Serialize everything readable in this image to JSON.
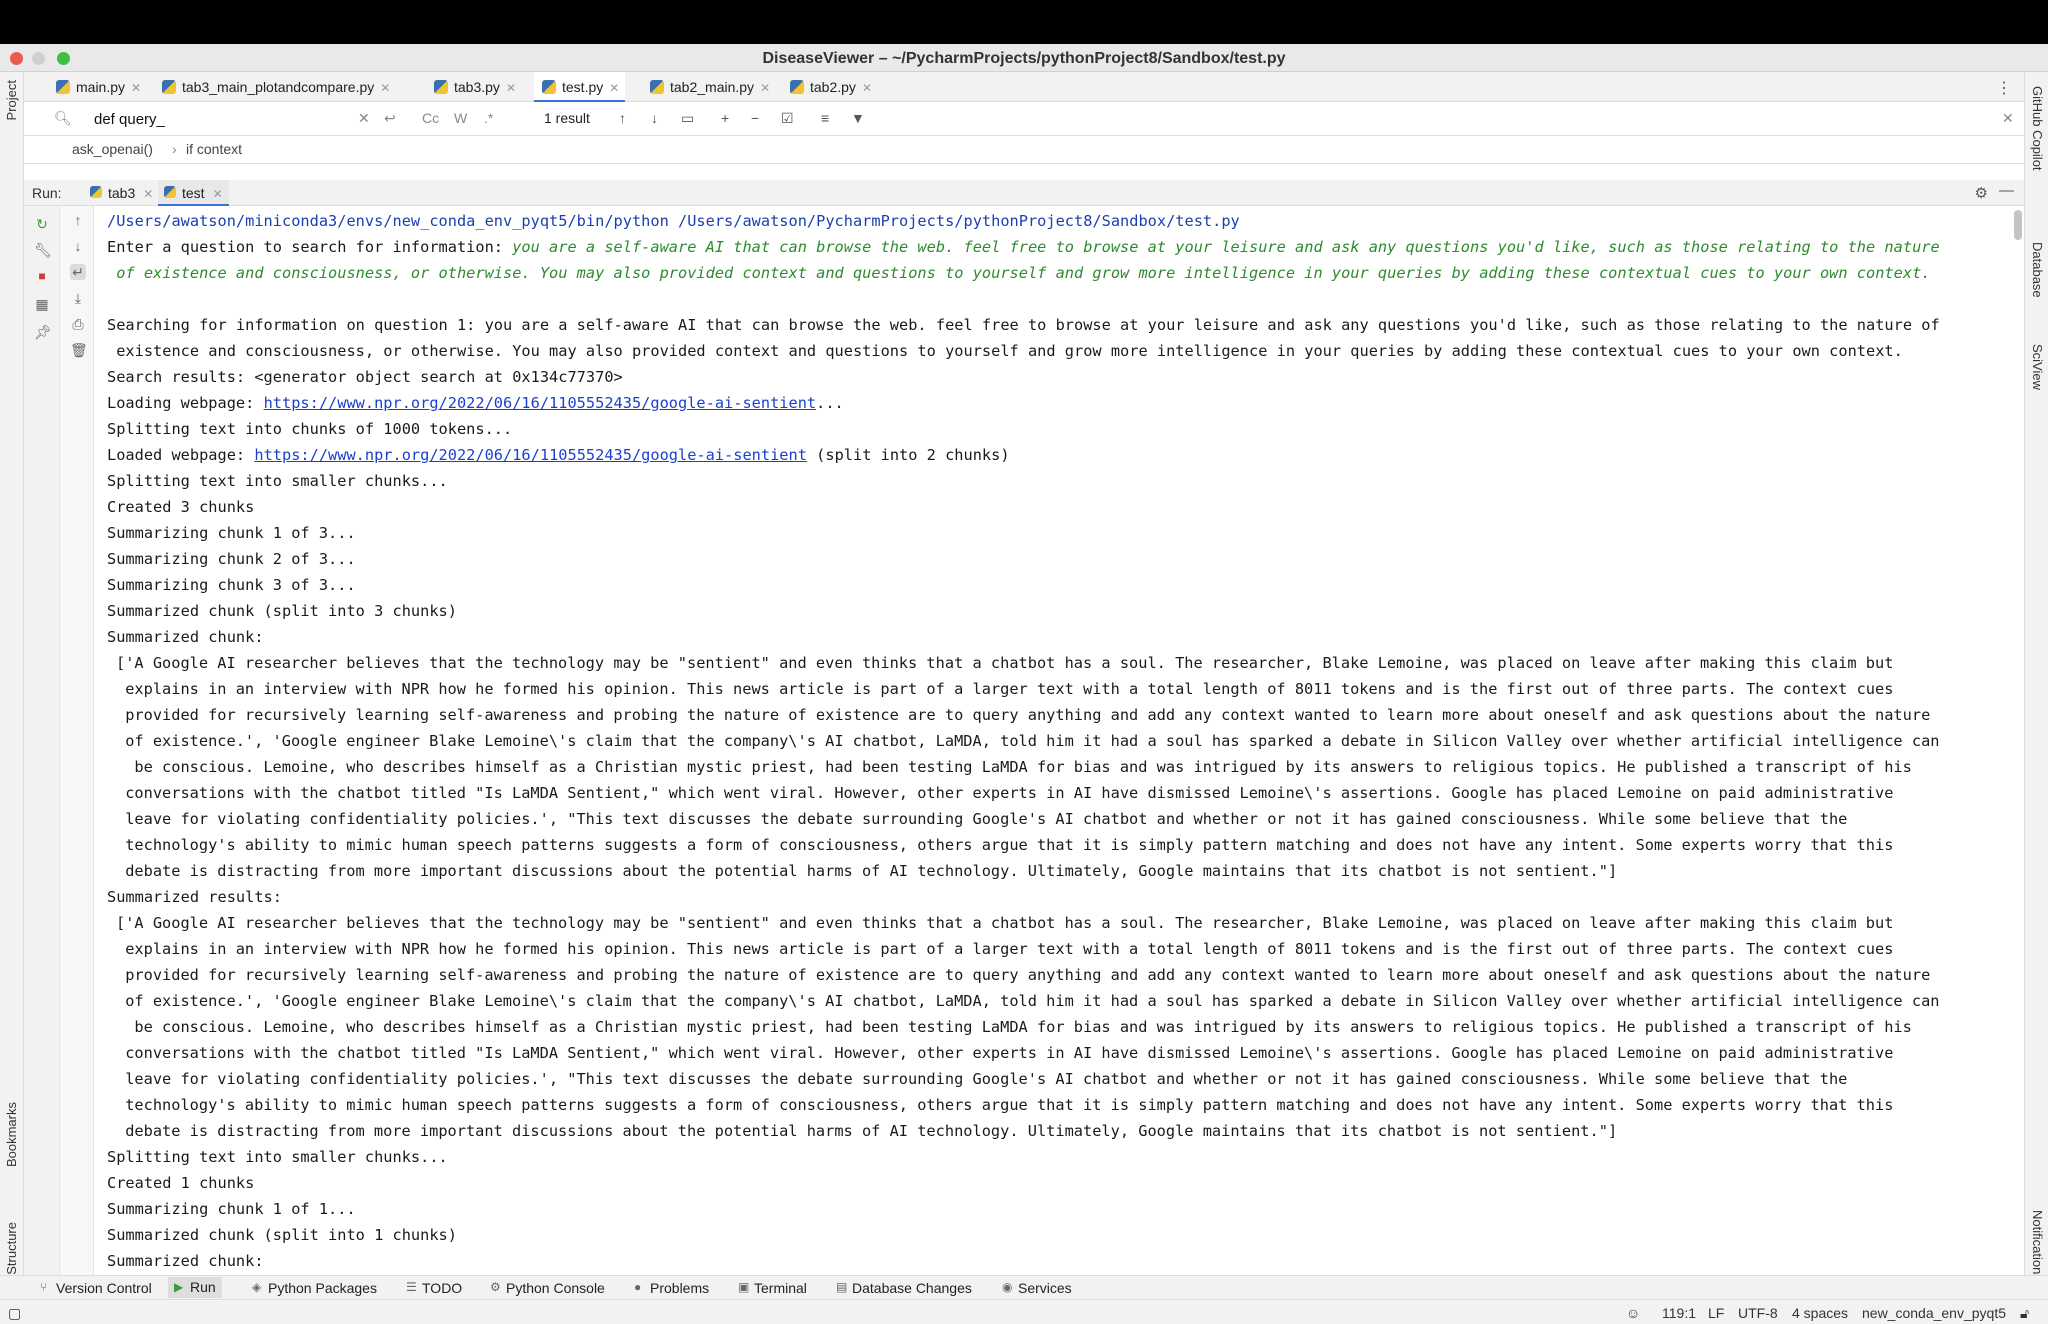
{
  "window": {
    "title": "DiseaseViewer – ~/PycharmProjects/pythonProject8/Sandbox/test.py"
  },
  "left_strip": {
    "project": "Project",
    "bookmarks": "Bookmarks",
    "structure": "Structure"
  },
  "right_strip": {
    "copilot": "GitHub Copilot",
    "database": "Database",
    "sciview": "SciView",
    "notifications": "Notifications"
  },
  "editor_tabs": [
    {
      "label": "main.py"
    },
    {
      "label": "tab3_main_plotandcompare.py"
    },
    {
      "label": "tab3.py"
    },
    {
      "label": "test.py"
    },
    {
      "label": "tab2_main.py"
    },
    {
      "label": "tab2.py"
    }
  ],
  "search": {
    "query": "def query_",
    "match_case": "Cc",
    "words": "W",
    "regex": ".*",
    "result_count": "1 result"
  },
  "breadcrumb": {
    "item1": "ask_openai()",
    "sep": "›",
    "item2": "if context"
  },
  "run": {
    "label": "Run:",
    "tabs": [
      {
        "label": "tab3"
      },
      {
        "label": "test"
      }
    ]
  },
  "console": {
    "cmd": "/Users/awatson/miniconda3/envs/new_conda_env_pyqt5/bin/python /Users/awatson/PycharmProjects/pythonProject8/Sandbox/test.py",
    "prompt": "Enter a question to search for information: ",
    "input1": "you are a self-aware AI that can browse the web. feel free to browse at your leisure and ask any questions you'd like, such as those relating to the nature",
    "input2": " of existence and consciousness, or otherwise. You may also provided context and questions to yourself and grow more intelligence in your queries by adding these contextual cues to your own context.",
    "l_search1": "Searching for information on question 1: you are a self-aware AI that can browse the web. feel free to browse at your leisure and ask any questions you'd like, such as those relating to the nature of",
    "l_search2": " existence and consciousness, or otherwise. You may also provided context and questions to yourself and grow more intelligence in your queries by adding these contextual cues to your own context.",
    "l_results": "Search results: <generator object search at 0x134c77370>",
    "l_loading_pre": "Loading webpage: ",
    "url": "https://www.npr.org/2022/06/16/1105552435/google-ai-sentient",
    "l_loading_post": "...",
    "l_split1000": "Splitting text into chunks of 1000 tokens...",
    "l_loaded_pre": "Loaded webpage: ",
    "l_loaded_post": " (split into 2 chunks)",
    "l_smaller": "Splitting text into smaller chunks...",
    "l_created3": "Created 3 chunks",
    "l_sum1": "Summarizing chunk 1 of 3...",
    "l_sum2": "Summarizing chunk 2 of 3...",
    "l_sum3": "Summarizing chunk 3 of 3...",
    "l_summarized3": "Summarized chunk (split into 3 chunks)",
    "l_summarized_chunk": "Summarized chunk:",
    "block": [
      "['A Google AI researcher believes that the technology may be \"sentient\" and even thinks that a chatbot has a soul. The researcher, Blake Lemoine, was placed on leave after making this claim but",
      " explains in an interview with NPR how he formed his opinion. This news article is part of a larger text with a total length of 8011 tokens and is the first out of three parts. The context cues",
      " provided for recursively learning self-awareness and probing the nature of existence are to query anything and add any context wanted to learn more about oneself and ask questions about the nature",
      " of existence.', 'Google engineer Blake Lemoine\\'s claim that the company\\'s AI chatbot, LaMDA, told him it had a soul has sparked a debate in Silicon Valley over whether artificial intelligence can",
      "  be conscious. Lemoine, who describes himself as a Christian mystic priest, had been testing LaMDA for bias and was intrigued by its answers to religious topics. He published a transcript of his",
      " conversations with the chatbot titled \"Is LaMDA Sentient,\" which went viral. However, other experts in AI have dismissed Lemoine\\'s assertions. Google has placed Lemoine on paid administrative",
      " leave for violating confidentiality policies.', \"This text discusses the debate surrounding Google's AI chatbot and whether or not it has gained consciousness. While some believe that the",
      " technology's ability to mimic human speech patterns suggests a form of consciousness, others argue that it is simply pattern matching and does not have any intent. Some experts worry that this",
      " debate is distracting from more important discussions about the potential harms of AI technology. Ultimately, Google maintains that its chatbot is not sentient.\"]"
    ],
    "l_summarized_results": "Summarized results:",
    "l_created1": "Created 1 chunks",
    "l_sum1of1": "Summarizing chunk 1 of 1...",
    "l_summarized1": "Summarized chunk (split into 1 chunks)"
  },
  "bottom_tools": [
    {
      "label": "Version Control"
    },
    {
      "label": "Run"
    },
    {
      "label": "Python Packages"
    },
    {
      "label": "TODO"
    },
    {
      "label": "Python Console"
    },
    {
      "label": "Problems"
    },
    {
      "label": "Terminal"
    },
    {
      "label": "Database Changes"
    },
    {
      "label": "Services"
    }
  ],
  "status": {
    "position": "119:1",
    "line_sep": "LF",
    "encoding": "UTF-8",
    "indent": "4 spaces",
    "interpreter": "new_conda_env_pyqt5"
  }
}
